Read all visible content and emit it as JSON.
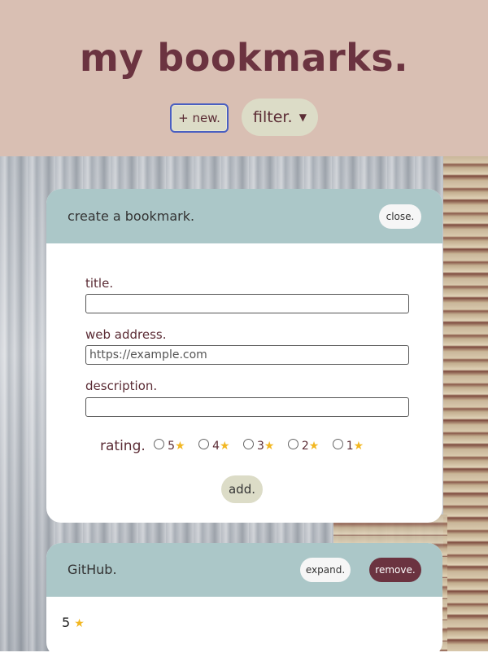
{
  "header": {
    "title": "my bookmarks.",
    "new_button": "+ new.",
    "filter": {
      "selected": "filter.",
      "icon": "chevron-down-icon"
    }
  },
  "create_form": {
    "heading": "create a bookmark.",
    "close_button": "close.",
    "fields": {
      "title_label": "title.",
      "title_value": "",
      "url_label": "web address.",
      "url_placeholder": "https://example.com",
      "description_label": "description.",
      "description_value": ""
    },
    "rating_label": "rating.",
    "rating_options": [
      "5",
      "4",
      "3",
      "2",
      "1"
    ],
    "add_button": "add."
  },
  "bookmarks": [
    {
      "title": "GitHub.",
      "rating": "5",
      "expand_button": "expand.",
      "remove_button": "remove."
    }
  ],
  "colors": {
    "accent": "#6b3340",
    "header_bg": "#d9bfb3",
    "card_header": "#abc7c8",
    "button_bg": "#dcdcc7"
  }
}
